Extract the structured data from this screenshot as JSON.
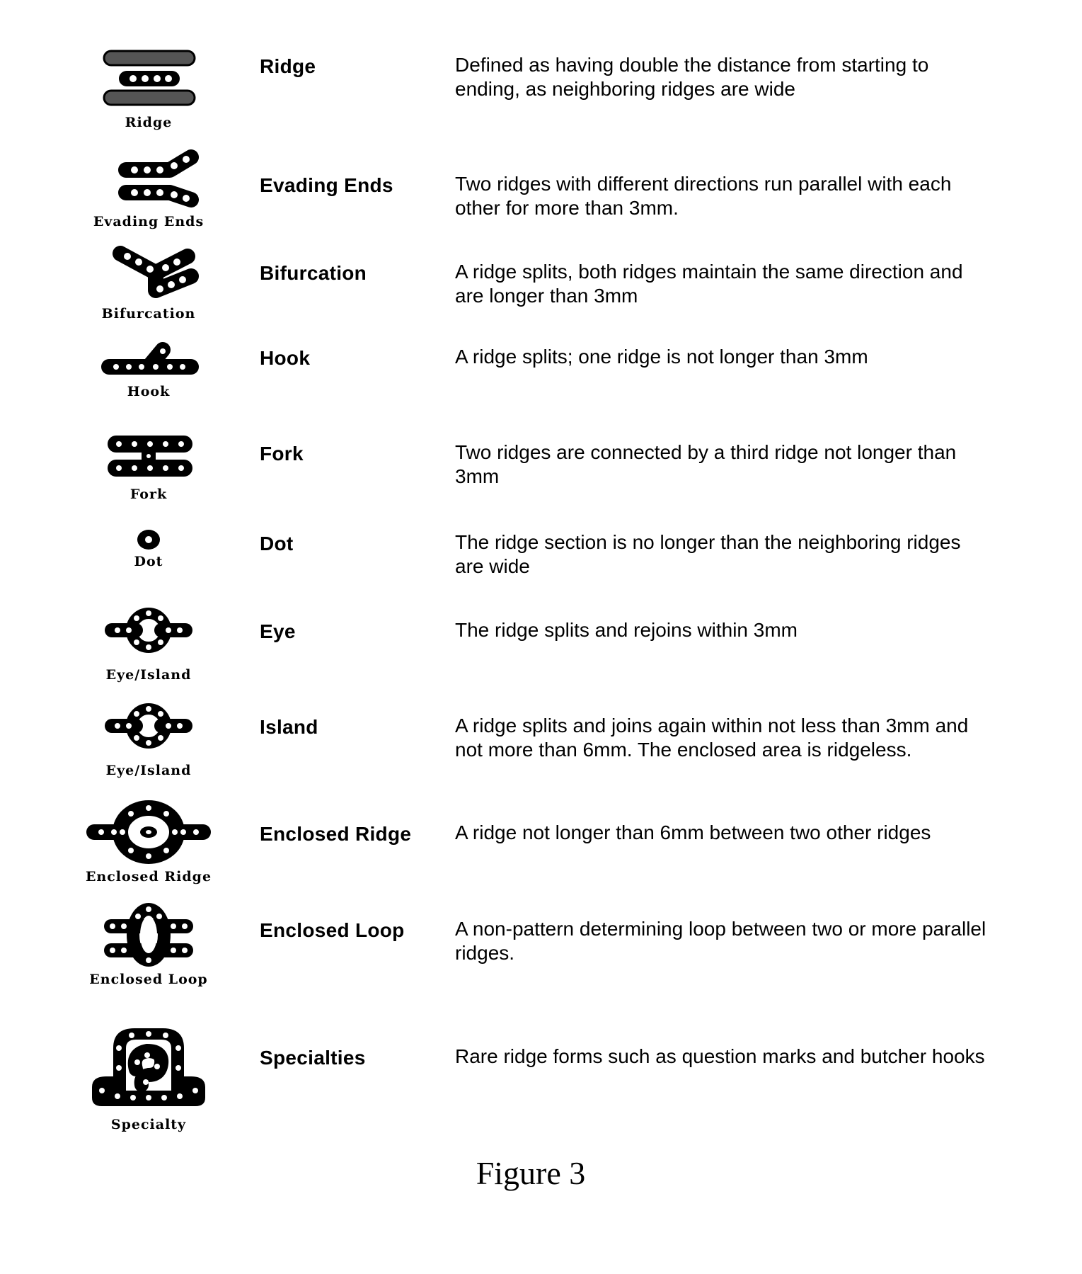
{
  "figure": {
    "label": "Figure 3"
  },
  "rows": [
    {
      "icon": "ridge-icon",
      "caption": "Ridge",
      "term": "Ridge",
      "definition": "Defined as having double the distance from starting to ending, as neighboring ridges are wide"
    },
    {
      "icon": "evading-ends-icon",
      "caption": "Evading Ends",
      "term": "Evading Ends",
      "definition": "Two ridges with different directions run parallel with each other for more than 3mm."
    },
    {
      "icon": "bifurcation-icon",
      "caption": "Bifurcation",
      "term": "Bifurcation",
      "definition": "A ridge splits, both ridges maintain the same direction and are longer than 3mm"
    },
    {
      "icon": "hook-icon",
      "caption": "Hook",
      "term": "Hook",
      "definition": "A ridge splits; one ridge is not longer than 3mm"
    },
    {
      "icon": "fork-icon",
      "caption": "Fork",
      "term": "Fork",
      "definition": "Two ridges are connected by a third ridge not longer than 3mm"
    },
    {
      "icon": "dot-icon",
      "caption": "Dot",
      "term": "Dot",
      "definition": "The ridge section is no longer than the neighboring ridges are wide"
    },
    {
      "icon": "eye-island-icon",
      "caption": "Eye/Island",
      "term": "Eye",
      "definition": "The ridge splits and rejoins within 3mm"
    },
    {
      "icon": "eye-island-icon",
      "caption": "Eye/Island",
      "term": "Island",
      "definition": "A ridge splits and joins again within not less than 3mm and not more than 6mm. The enclosed area is ridgeless."
    },
    {
      "icon": "enclosed-ridge-icon",
      "caption": "Enclosed Ridge",
      "term": "Enclosed Ridge",
      "definition": "A ridge not longer than 6mm between two other ridges"
    },
    {
      "icon": "enclosed-loop-icon",
      "caption": "Enclosed Loop",
      "term": "Enclosed Loop",
      "definition": "A non-pattern determining loop between two or more parallel ridges."
    },
    {
      "icon": "specialty-icon",
      "caption": "Specialty",
      "term": "Specialties",
      "definition": "Rare ridge forms such as question marks and butcher hooks"
    }
  ]
}
